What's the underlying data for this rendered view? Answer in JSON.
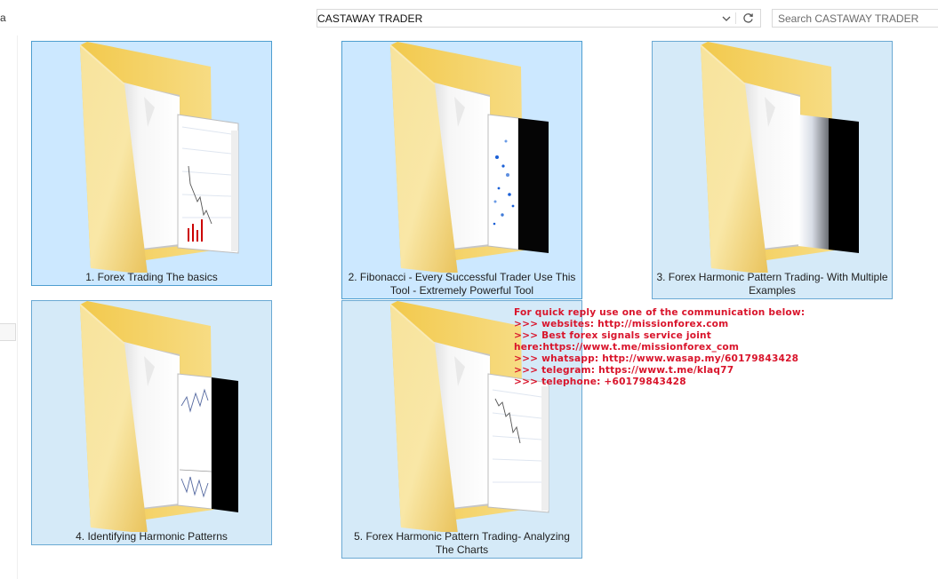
{
  "window": {
    "left_stub": "a"
  },
  "address_bar": {
    "path": "CASTAWAY TRADER"
  },
  "search": {
    "placeholder": "Search CASTAWAY TRADER"
  },
  "folders": [
    {
      "label": "1. Forex Trading The basics",
      "preview": "price-chart"
    },
    {
      "label": "2. Fibonacci - Every Successful Trader Use This Tool - Extremely Powerful Tool",
      "preview": "scatter-dark"
    },
    {
      "label": "3. Forex Harmonic Pattern Trading- With Multiple Examples",
      "preview": "gradient-dark"
    },
    {
      "label": "4. Identifying Harmonic Patterns",
      "preview": "price-chart-dark"
    },
    {
      "label": "5. Forex Harmonic Pattern Trading- Analyzing The Charts",
      "preview": "price-chart"
    }
  ],
  "overlay_text": {
    "lines": [
      "For quick reply use one of the communication below:",
      ">>> websites: http://missionforex.com",
      ">>> Best forex signals service joint",
      "here:https://www.t.me/missionforex_com",
      ">>> whatsapp: http://www.wasap.my/60179843428",
      ">>> telegram: https://www.t.me/klaq77",
      ">>> telephone: +60179843428"
    ],
    "color": "#d9142b"
  },
  "colors": {
    "tile_selected_bg": "#cce8ff",
    "tile_border": "#4e9ed0",
    "folder_yellow": "#f5d97a"
  },
  "icons": {
    "dropdown": "chevron-down-icon",
    "refresh": "refresh-icon",
    "folder": "folder-icon"
  }
}
